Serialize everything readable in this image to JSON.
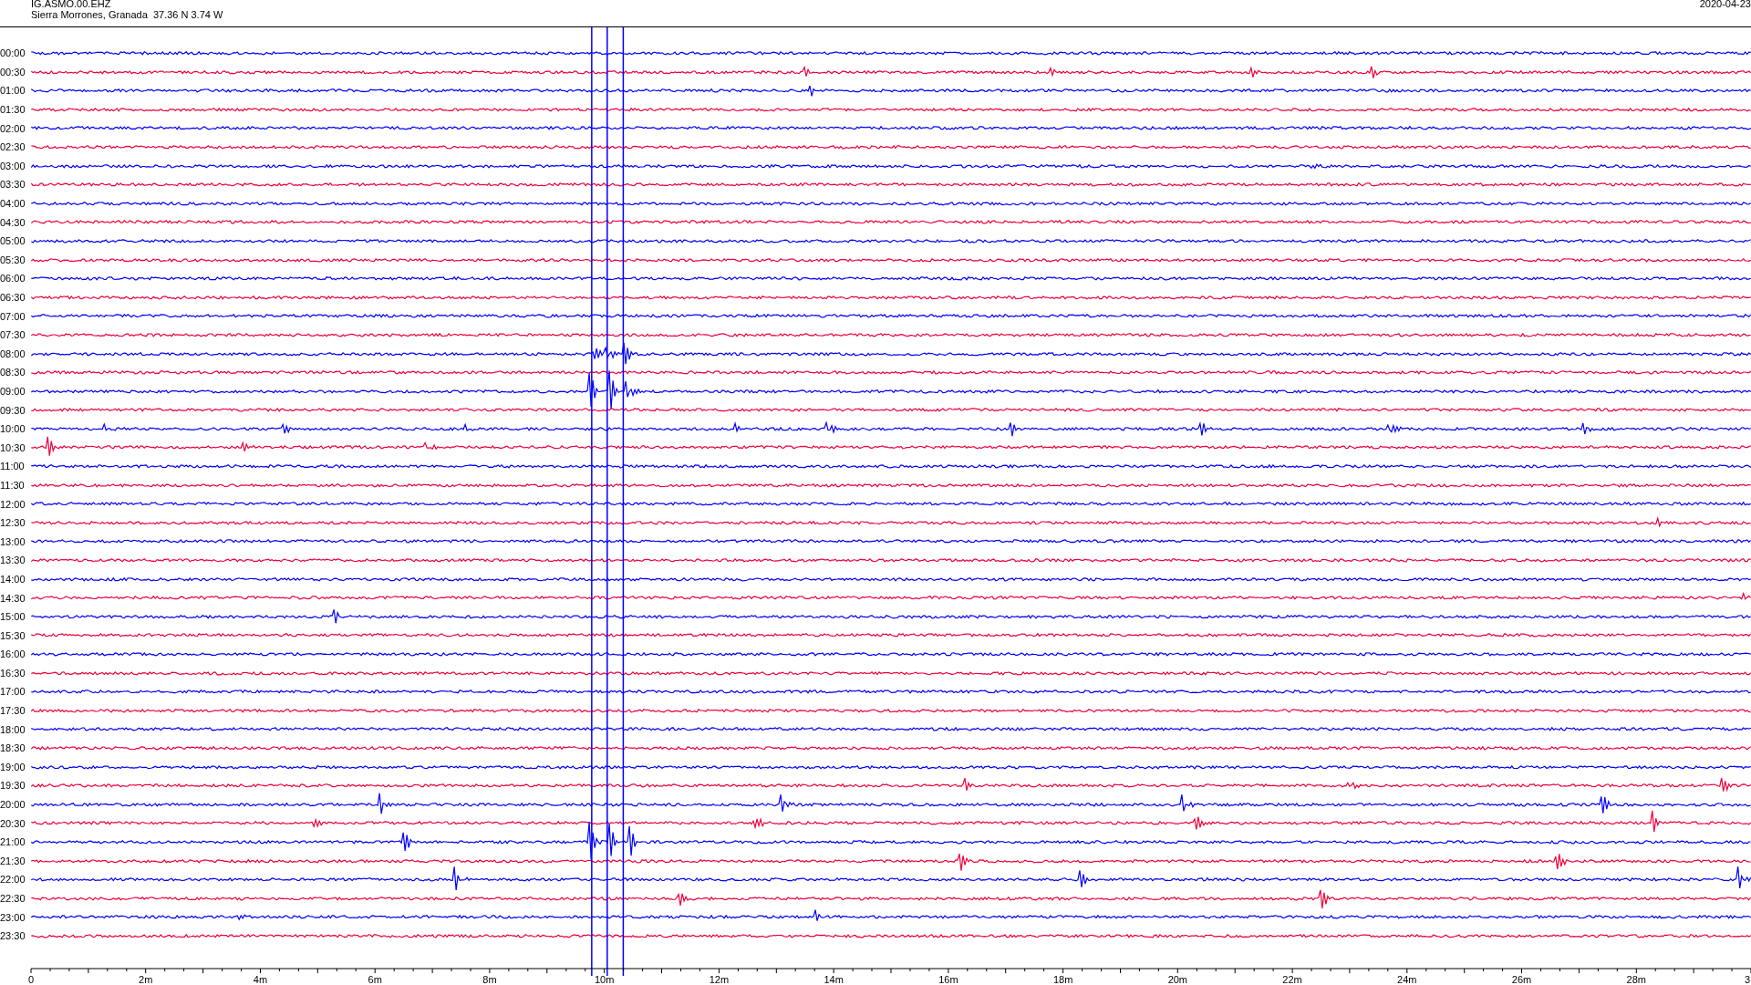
{
  "header": {
    "station": "IG.ASMO.00.EHZ",
    "location": "Sierra Morrones, Granada  37.36 N 3.74 W",
    "date": "2020-04-23"
  },
  "traces": [
    {
      "time": "00:00",
      "color": "#0000ff"
    },
    {
      "time": "00:30",
      "color": "#f0003c"
    },
    {
      "time": "01:00",
      "color": "#0000ff"
    },
    {
      "time": "01:30",
      "color": "#f0003c"
    },
    {
      "time": "02:00",
      "color": "#0000ff"
    },
    {
      "time": "02:30",
      "color": "#f0003c"
    },
    {
      "time": "03:00",
      "color": "#0000ff"
    },
    {
      "time": "03:30",
      "color": "#f0003c"
    },
    {
      "time": "04:00",
      "color": "#0000ff"
    },
    {
      "time": "04:30",
      "color": "#f0003c"
    },
    {
      "time": "05:00",
      "color": "#0000ff"
    },
    {
      "time": "05:30",
      "color": "#f0003c"
    },
    {
      "time": "06:00",
      "color": "#0000ff"
    },
    {
      "time": "06:30",
      "color": "#f0003c"
    },
    {
      "time": "07:00",
      "color": "#0000ff"
    },
    {
      "time": "07:30",
      "color": "#f0003c"
    },
    {
      "time": "08:00",
      "color": "#0000ff"
    },
    {
      "time": "08:30",
      "color": "#f0003c"
    },
    {
      "time": "09:00",
      "color": "#0000ff"
    },
    {
      "time": "09:30",
      "color": "#f0003c"
    },
    {
      "time": "10:00",
      "color": "#0000ff"
    },
    {
      "time": "10:30",
      "color": "#f0003c"
    },
    {
      "time": "11:00",
      "color": "#0000ff"
    },
    {
      "time": "11:30",
      "color": "#f0003c"
    },
    {
      "time": "12:00",
      "color": "#0000ff"
    },
    {
      "time": "12:30",
      "color": "#f0003c"
    },
    {
      "time": "13:00",
      "color": "#0000ff"
    },
    {
      "time": "13:30",
      "color": "#f0003c"
    },
    {
      "time": "14:00",
      "color": "#0000ff"
    },
    {
      "time": "14:30",
      "color": "#f0003c"
    },
    {
      "time": "15:00",
      "color": "#0000ff"
    },
    {
      "time": "15:30",
      "color": "#f0003c"
    },
    {
      "time": "16:00",
      "color": "#0000ff"
    },
    {
      "time": "16:30",
      "color": "#f0003c"
    },
    {
      "time": "17:00",
      "color": "#0000ff"
    },
    {
      "time": "17:30",
      "color": "#f0003c"
    },
    {
      "time": "18:00",
      "color": "#0000ff"
    },
    {
      "time": "18:30",
      "color": "#f0003c"
    },
    {
      "time": "19:00",
      "color": "#0000ff"
    },
    {
      "time": "19:30",
      "color": "#f0003c"
    },
    {
      "time": "20:00",
      "color": "#0000ff"
    },
    {
      "time": "20:30",
      "color": "#f0003c"
    },
    {
      "time": "21:00",
      "color": "#0000ff"
    },
    {
      "time": "21:30",
      "color": "#f0003c"
    },
    {
      "time": "22:00",
      "color": "#0000ff"
    },
    {
      "time": "22:30",
      "color": "#f0003c"
    },
    {
      "time": "23:00",
      "color": "#0000ff"
    },
    {
      "time": "23:30",
      "color": "#f0003c"
    }
  ],
  "axis": {
    "ticks": [
      "0",
      "2m",
      "4m",
      "6m",
      "8m",
      "10m",
      "12m",
      "14m",
      "16m",
      "18m",
      "20m",
      "22m",
      "24m",
      "26m",
      "28m",
      "3"
    ]
  }
}
